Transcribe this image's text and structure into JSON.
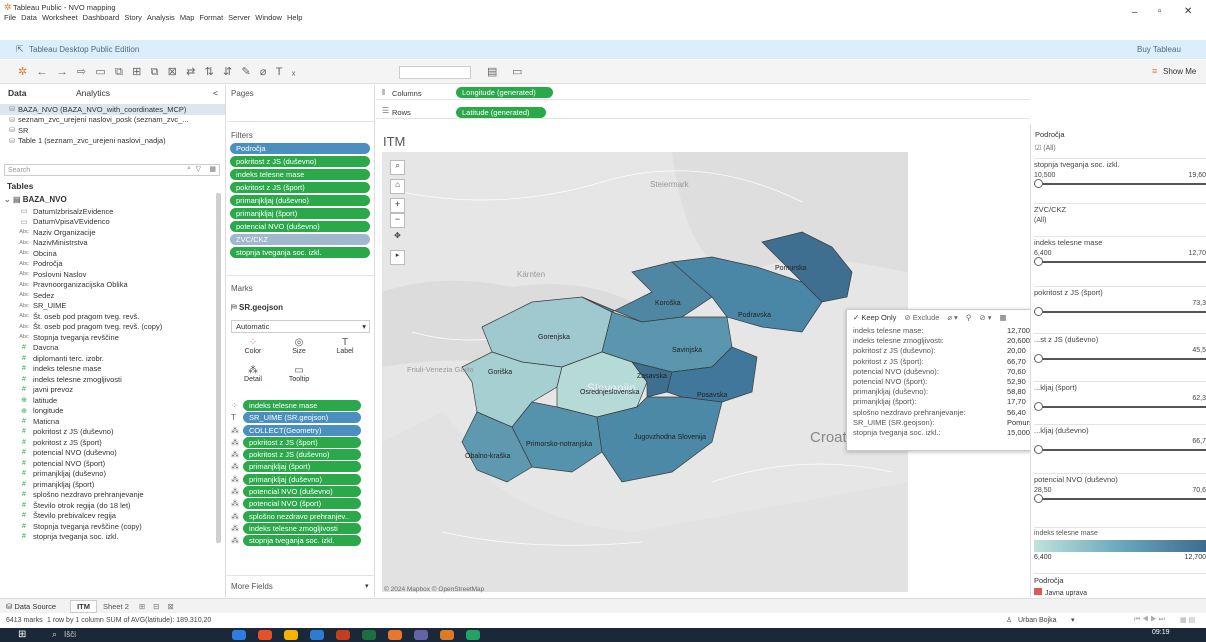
{
  "window": {
    "title": "Tableau Public - NVO mapping",
    "min": "–",
    "max": "▫",
    "close": "✕"
  },
  "menu": [
    "File",
    "Data",
    "Worksheet",
    "Dashboard",
    "Story",
    "Analysis",
    "Map",
    "Format",
    "Server",
    "Window",
    "Help"
  ],
  "edition": {
    "label": "Tableau Desktop Public Edition",
    "buy": "Buy Tableau"
  },
  "toolbar": {
    "show_me": "Show Me"
  },
  "data_pane": {
    "tab_data": "Data",
    "tab_analytics": "Analytics",
    "collapse": "<",
    "sources": [
      "BAZA_NVO (BAZA_NVO_with_coordinates_MCP)",
      "seznam_zvc_urejeni naslovi_posk (seznam_zvc_...",
      "SR",
      "Table 1 (seznam_zvc_urejeni naslovi_nadja)"
    ],
    "search_placeholder": "Search",
    "tables_label": "Tables",
    "table_name": "BAZA_NVO",
    "fields": [
      {
        "t": "date",
        "n": "DatumIzbrisalzEvidence"
      },
      {
        "t": "date",
        "n": "DatumVpisaVEvidenco"
      },
      {
        "t": "abc",
        "n": "Naziv Organizacije"
      },
      {
        "t": "abc",
        "n": "NazivMinistrstva"
      },
      {
        "t": "abc",
        "n": "Obcina"
      },
      {
        "t": "abc",
        "n": "Področja"
      },
      {
        "t": "abc",
        "n": "Poslovni Naslov"
      },
      {
        "t": "abc",
        "n": "Pravnoorganizacijska Oblika"
      },
      {
        "t": "abc",
        "n": "Sedez"
      },
      {
        "t": "abc",
        "n": "SR_UIME"
      },
      {
        "t": "abc",
        "n": "Št. oseb pod pragom tveg. revš."
      },
      {
        "t": "abc",
        "n": "Št. oseb pod pragom tveg. revš. (copy)"
      },
      {
        "t": "abc",
        "n": "Stopnja tveganja revščine"
      },
      {
        "t": "num",
        "n": "Davcna"
      },
      {
        "t": "num",
        "n": "diplomanti terc. izobr."
      },
      {
        "t": "num",
        "n": "indeks telesne mase"
      },
      {
        "t": "num",
        "n": "indeks telesne zmogljivosti"
      },
      {
        "t": "num",
        "n": "javni prevoz"
      },
      {
        "t": "geo",
        "n": "latitude"
      },
      {
        "t": "geo",
        "n": "longitude"
      },
      {
        "t": "num",
        "n": "Maticna"
      },
      {
        "t": "num",
        "n": "pokritost z JS (duševno)"
      },
      {
        "t": "num",
        "n": "pokritost z JS (šport)"
      },
      {
        "t": "num",
        "n": "potencial NVO (duševno)"
      },
      {
        "t": "num",
        "n": "potencial NVO (šport)"
      },
      {
        "t": "num",
        "n": "primanjkljaj (duševno)"
      },
      {
        "t": "num",
        "n": "primanjkljaj (šport)"
      },
      {
        "t": "num",
        "n": "splošno nezdravo prehranjevanje"
      },
      {
        "t": "num",
        "n": "Število otrok regija (do 18 let)"
      },
      {
        "t": "num",
        "n": "Število prebivalcev regija"
      },
      {
        "t": "num",
        "n": "Stopnja tveganja revščine (copy)"
      },
      {
        "t": "num",
        "n": "stopnja tveganja soc. izkl."
      }
    ]
  },
  "pages": {
    "label": "Pages"
  },
  "filters": {
    "label": "Filters",
    "items": [
      {
        "n": "Področja",
        "c": "b"
      },
      {
        "n": "pokritost z JS (duševno)",
        "c": "g"
      },
      {
        "n": "indeks telesne mase",
        "c": "g"
      },
      {
        "n": "pokritost z JS (šport)",
        "c": "g"
      },
      {
        "n": "primanjkljaj (duševno)",
        "c": "g"
      },
      {
        "n": "primanjkljaj (šport)",
        "c": "g"
      },
      {
        "n": "potencial NVO (duševno)",
        "c": "g"
      },
      {
        "n": "ZVC/CKZ",
        "c": "lb"
      },
      {
        "n": "stopnja tveganja soc. izkl.",
        "c": "g"
      }
    ]
  },
  "marks": {
    "label": "Marks",
    "layer": "SR.geojson",
    "type": "Automatic",
    "buttons": [
      "Color",
      "Size",
      "Label",
      "Detail",
      "Tooltip"
    ],
    "cards": [
      {
        "i": "color",
        "n": "indeks telesne mase",
        "c": "g"
      },
      {
        "i": "label",
        "n": "SR_UIME (SR.geojson)",
        "c": "b"
      },
      {
        "i": "detail",
        "n": "COLLECT(Geometry)",
        "c": "b"
      },
      {
        "i": "detail",
        "n": "pokritost z JS (šport)",
        "c": "g"
      },
      {
        "i": "detail",
        "n": "pokritost z JS (duševno)",
        "c": "g"
      },
      {
        "i": "detail",
        "n": "primanjkljaj (šport)",
        "c": "g"
      },
      {
        "i": "detail",
        "n": "primanjkljaj (duševno)",
        "c": "g"
      },
      {
        "i": "detail",
        "n": "potencial NVO (duševno)",
        "c": "g"
      },
      {
        "i": "detail",
        "n": "potencial NVO (šport)",
        "c": "g"
      },
      {
        "i": "detail",
        "n": "splošno nezdravo prehranjev..",
        "c": "g"
      },
      {
        "i": "detail",
        "n": "indeks telesne zmogljivosti",
        "c": "g"
      },
      {
        "i": "detail",
        "n": "stopnja tveganja soc. izkl.",
        "c": "g"
      }
    ]
  },
  "more_fields": "More Fields",
  "shelves": {
    "columns_label": "Columns",
    "columns_pill": "Longitude (generated)",
    "rows_label": "Rows",
    "rows_pill": "Latitude (generated)"
  },
  "sheet": {
    "title": "ITM",
    "attribution": "© 2024 Mapbox © OpenStreetMap",
    "map_labels": {
      "steiermark": "Steiermark",
      "karnten": "Kärnten",
      "friuli": "Friuli-Venezia Giulia",
      "croat": "Croat",
      "slovenia": "Slovenija"
    },
    "regions": {
      "pomurska": "Pomurska",
      "koroska": "Koroška",
      "podravska": "Podravska",
      "gorenjska": "Gorenjska",
      "savinjska": "Savinjska",
      "goriska": "Goriška",
      "osrednjeslovenska": "Osrednjeslovenska",
      "zasavska": "Zasavska",
      "posavska": "Posavska",
      "primorsko": "Primorsko-notranjska",
      "jugovzhodna": "Jugovzhodna Slovenija",
      "obalno": "Obalno-kraška"
    }
  },
  "tooltip": {
    "keep": "✓ Keep Only",
    "exclude": "⊘ Exclude",
    "rows": [
      {
        "k": "indeks telesne mase:",
        "v": "12,700"
      },
      {
        "k": "indeks telesne zmogljivosti:",
        "v": "20,600"
      },
      {
        "k": "pokritost z JS (duševno):",
        "v": "20,00"
      },
      {
        "k": "pokritost z JS (šport):",
        "v": "66,70"
      },
      {
        "k": "potencial NVO (duševno):",
        "v": "70,60"
      },
      {
        "k": "potencial NVO (šport):",
        "v": "52,90"
      },
      {
        "k": "primanjkljaj (duševno):",
        "v": "58,80"
      },
      {
        "k": "primanjkljaj (šport):",
        "v": "17,70"
      },
      {
        "k": "splošno nezdravo prehranjevanje:",
        "v": "56,40"
      },
      {
        "k": "SR_UIME (SR.geojson):",
        "v": "Pomurska"
      },
      {
        "k": "stopnja tveganja soc. izkl.:",
        "v": "15,000"
      }
    ]
  },
  "right_panel": {
    "podrocja": "Področja",
    "all": "(All)",
    "sliders": [
      {
        "t": "stopnja tveganja soc. izkl.",
        "min": "10,500",
        "max": "19,60"
      },
      {
        "t": "ZVC/CKZ",
        "min": "(All)",
        "max": ""
      },
      {
        "t": "indeks telesne mase",
        "min": "6,400",
        "max": "12,70"
      },
      {
        "t": "pokritost z JS (šport)",
        "min": "",
        "max": "73,3"
      },
      {
        "t": "...st z JS (duševno)",
        "min": "",
        "max": "45,5"
      },
      {
        "t": "...kljaj (šport)",
        "min": "",
        "max": "62,3"
      },
      {
        "t": "...kljaj (duševno)",
        "min": "",
        "max": "66,7"
      },
      {
        "t": "potencial NVO (duševno)",
        "min": "28,50",
        "max": "70,6"
      }
    ],
    "legend_title": "indeks telesne mase",
    "legend_min": "6,400",
    "legend_max": "12,700",
    "podrocja2": "Področja",
    "legend_item": "Javna uprava"
  },
  "tabs": {
    "data_source": "Data Source",
    "items": [
      "ITM",
      "Sheet 2"
    ]
  },
  "status": {
    "marks": "6413 marks",
    "rows": "1 row by 1 column",
    "sum": "SUM of AVG(latitude): 189.310,20",
    "user": "Urban Bojka"
  },
  "taskbar": {
    "search": "Išči",
    "time": "09:19"
  }
}
